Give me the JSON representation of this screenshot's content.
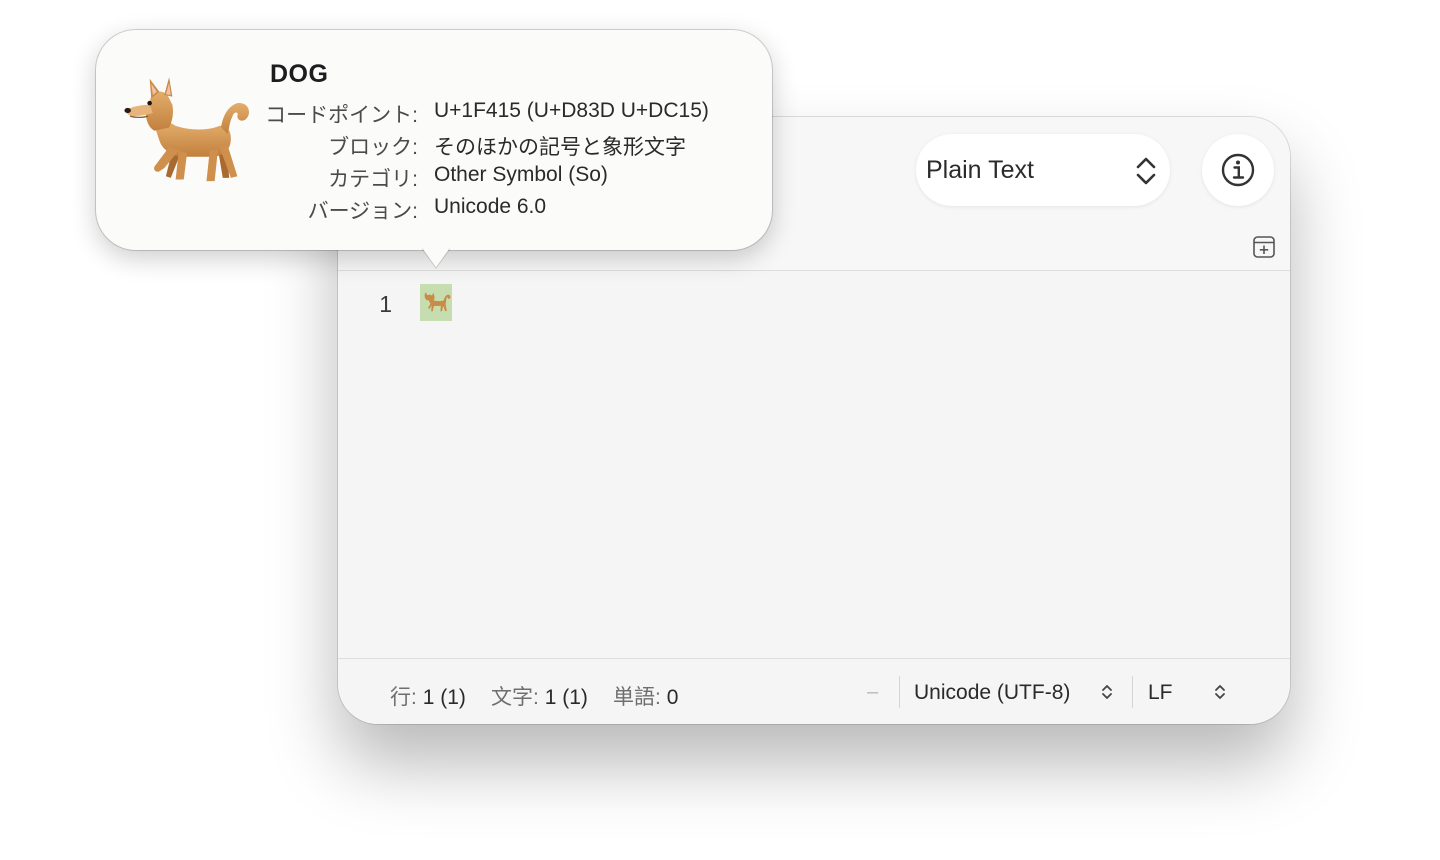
{
  "syntax_selector": {
    "label": "Plain Text",
    "icon": "up-down-chevron-icon"
  },
  "toolbar": {
    "info_icon": "info-circle-icon",
    "add_panel_icon": "add-panel-icon"
  },
  "editor": {
    "lines": [
      {
        "number": "1",
        "content": "🐕"
      }
    ]
  },
  "status_bar": {
    "line_label": "行:",
    "line_value": "1 (1)",
    "char_label": "文字:",
    "char_value": "1 (1)",
    "word_label": "単語:",
    "word_value": "0",
    "dash": "–",
    "encoding": "Unicode (UTF-8)",
    "line_ending": "LF"
  },
  "popover": {
    "name": "DOG",
    "rows": [
      {
        "key": "コードポイント:",
        "value": "U+1F415 (U+D83D U+DC15)"
      },
      {
        "key": "ブロック:",
        "value": "そのほかの記号と象形文字"
      },
      {
        "key": "カテゴリ:",
        "value": "Other Symbol (So)"
      },
      {
        "key": "バージョン:",
        "value": "Unicode 6.0"
      }
    ]
  },
  "colors": {
    "selection": "#c6ddb0",
    "window_bg": "#f5f5f5",
    "popover_bg": "#fbfbfa"
  }
}
